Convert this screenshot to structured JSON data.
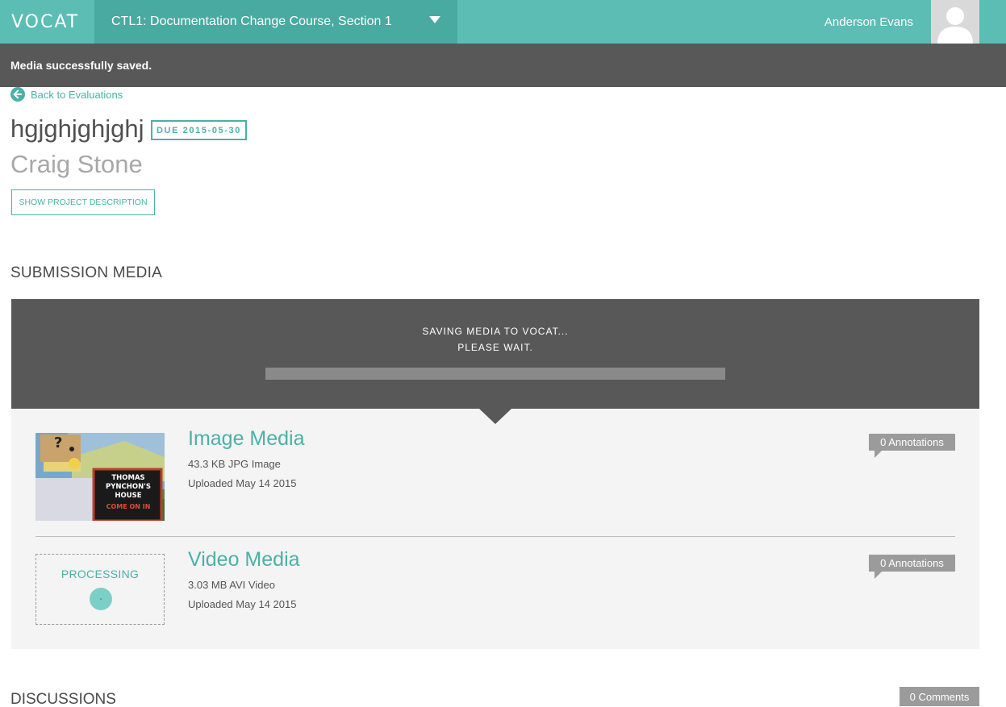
{
  "header": {
    "logo": "VOCAT",
    "course": "CTL1: Documentation Change Course, Section 1",
    "user_name": "Anderson Evans"
  },
  "flash": {
    "message": "Media successfully saved."
  },
  "nav": {
    "back_label": "Back to Evaluations"
  },
  "project": {
    "title": "hgjghjghjghj",
    "due_label": "DUE 2015-05-30",
    "student": "Craig Stone",
    "show_description_label": "SHOW PROJECT DESCRIPTION"
  },
  "submission": {
    "heading": "SUBMISSION MEDIA",
    "saving_line1": "SAVING MEDIA TO VOCAT...",
    "saving_line2": "PLEASE WAIT.",
    "progress": 0,
    "media": [
      {
        "title": "Image Media",
        "size": "43.3 KB JPG Image",
        "uploaded": "Uploaded May 14 2015",
        "annotations": "0 Annotations",
        "thumb_sign": [
          "THOMAS",
          "PYNCHON'S",
          "HOUSE",
          "COME ON IN"
        ]
      },
      {
        "title": "Video Media",
        "size": "3.03 MB AVI Video",
        "uploaded": "Uploaded May 14 2015",
        "annotations": "0 Annotations",
        "status": "PROCESSING"
      }
    ]
  },
  "discussions": {
    "heading": "DISCUSSIONS",
    "comments": "0 Comments"
  },
  "colors": {
    "brand": "#5bbdb4",
    "brand_dark": "#48aaa1",
    "accent": "#4ab1a8",
    "dark_panel": "#585858",
    "badge_gray": "#9b9b9b"
  },
  "icons": {
    "back": "arrow-left-circle-icon",
    "dropdown": "caret-down-icon",
    "avatar": "user-silhouette-icon",
    "spinner": "loading-spinner-icon"
  }
}
